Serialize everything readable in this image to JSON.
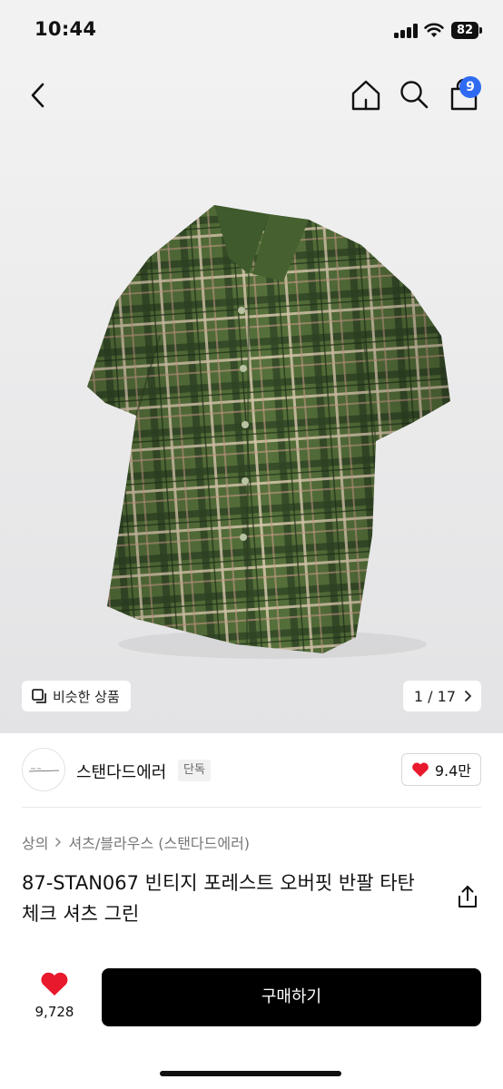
{
  "status": {
    "time": "10:44",
    "battery": "82"
  },
  "nav": {
    "cart_badge": "9",
    "icons": [
      "chevron-left-icon",
      "home-icon",
      "search-icon",
      "shopping-bag-icon"
    ]
  },
  "gallery": {
    "similar_label": "비슷한 상품",
    "page_indicator": "1 / 17",
    "current_page": 1,
    "total_pages": 17
  },
  "brand": {
    "name": "스탠다드에러",
    "tag": "단독",
    "likes": "9.4만"
  },
  "product": {
    "breadcrumb": [
      "상의",
      "셔츠/블라우스 (스탠다드에러)"
    ],
    "title": "87-STAN067 빈티지 포레스트 오버핏 반팔 타탄 체크 셔츠 그린"
  },
  "purchase": {
    "wish_count": "9,728",
    "buy_label": "구매하기"
  },
  "colors": {
    "accent_badge": "#2f6bf2",
    "heart": "#e8192c",
    "buy_button": "#000000",
    "shirt_green": "#4f6a34"
  }
}
